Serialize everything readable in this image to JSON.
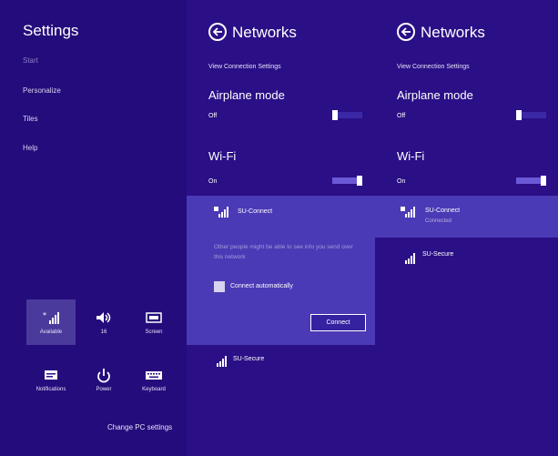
{
  "settings": {
    "title": "Settings",
    "links": [
      "Start",
      "Personalize",
      "Tiles",
      "Help"
    ],
    "quick_settings": [
      {
        "icon": "wifi-signal-icon",
        "label": "Available"
      },
      {
        "icon": "volume-icon",
        "label": "16"
      },
      {
        "icon": "screen-icon",
        "label": "Screen"
      },
      {
        "icon": "notifications-icon",
        "label": "Notifications"
      },
      {
        "icon": "power-icon",
        "label": "Power"
      },
      {
        "icon": "keyboard-icon",
        "label": "Keyboard"
      }
    ],
    "change_pc_settings": "Change PC settings"
  },
  "networks_a": {
    "title": "Networks",
    "view_connection_settings": "View Connection Settings",
    "airplane_mode": {
      "label": "Airplane mode",
      "state": "Off"
    },
    "wifi": {
      "label": "Wi-Fi",
      "state": "On"
    },
    "expanded_network": {
      "name": "SU-Connect",
      "warning": "Other people might be able to see info you send over this network",
      "connect_automatically": "Connect automatically",
      "connect_button": "Connect"
    },
    "other_network": {
      "name": "SU-Secure"
    }
  },
  "networks_b": {
    "title": "Networks",
    "view_connection_settings": "View Connection Settings",
    "airplane_mode": {
      "label": "Airplane mode",
      "state": "Off"
    },
    "wifi": {
      "label": "Wi-Fi",
      "state": "On"
    },
    "connected_network": {
      "name": "SU-Connect",
      "status": "Connected"
    },
    "other_network": {
      "name": "SU-Secure"
    }
  },
  "colors": {
    "panel_bg": "#2b0f86",
    "accent": "#4a3ab6",
    "toggle_on": "#6a58d6"
  }
}
